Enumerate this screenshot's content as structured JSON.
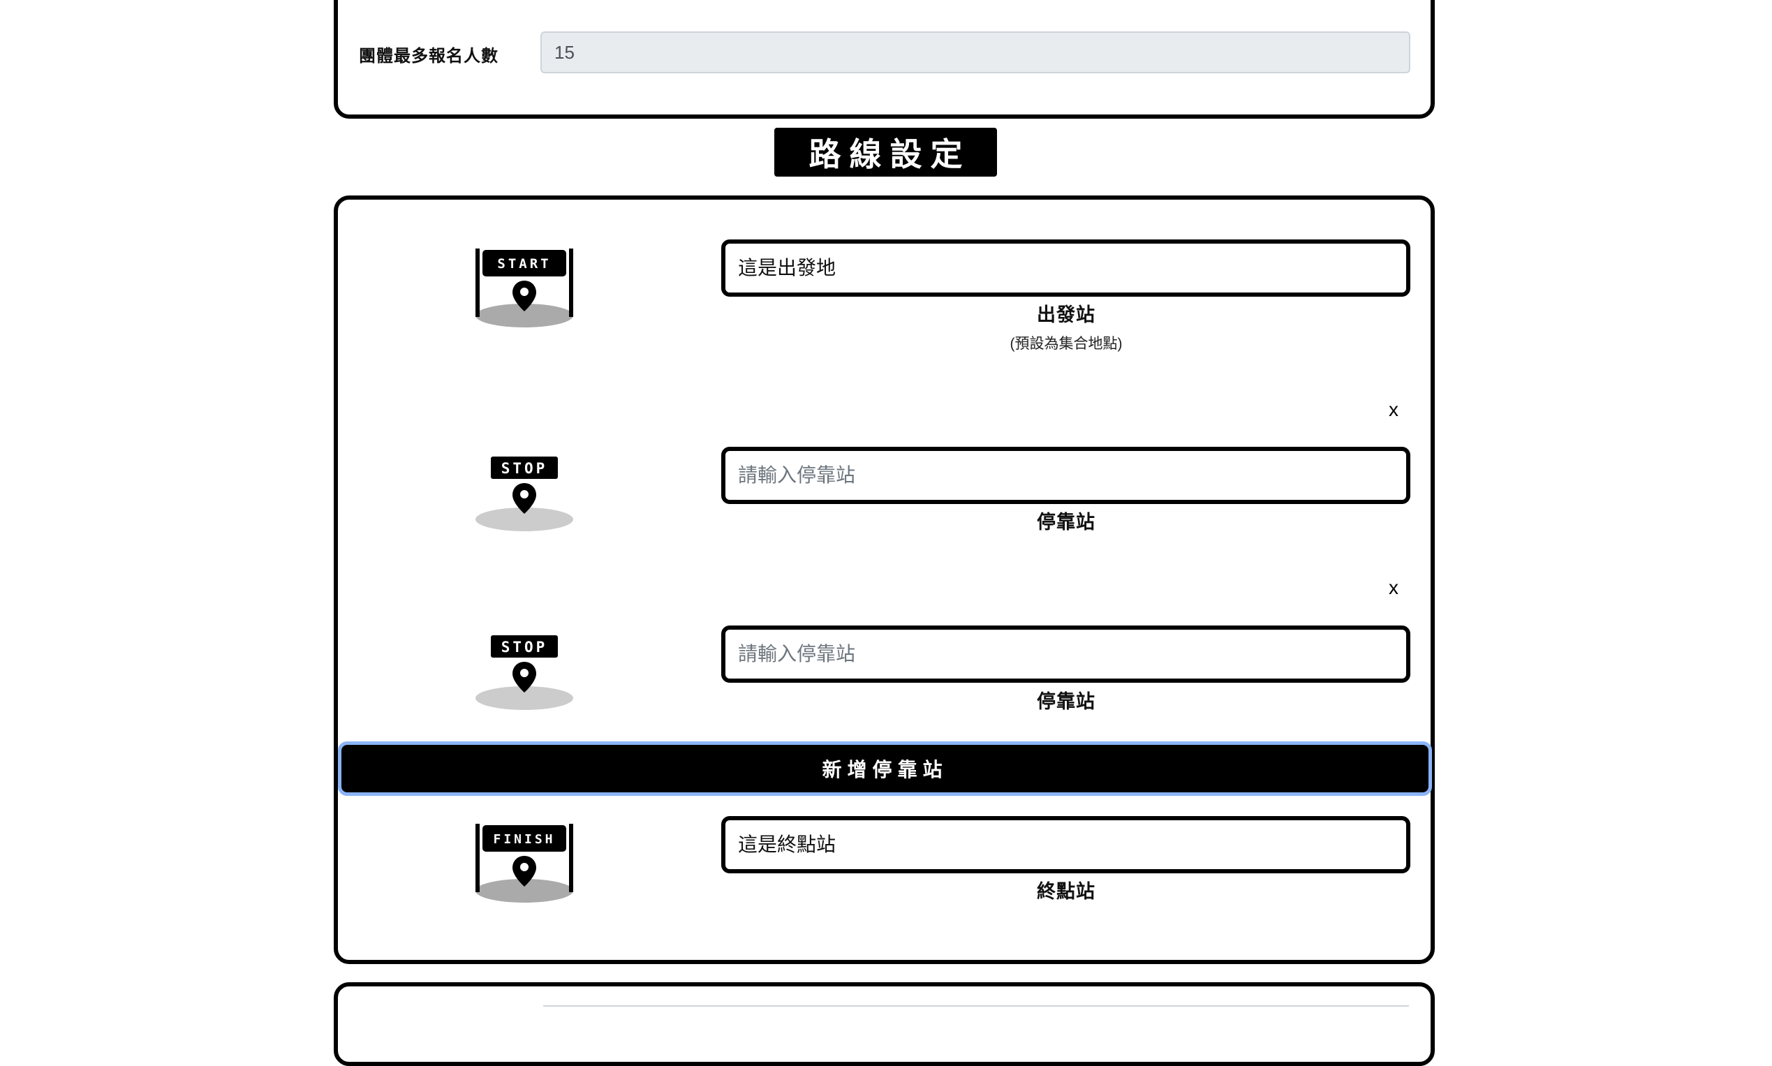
{
  "group_settings": {
    "max_signup_label": "團體最多報名人數",
    "max_signup_value": "15"
  },
  "route_settings": {
    "title": "路線設定",
    "start": {
      "badge": "START",
      "value": "這是出發地",
      "label": "出發站",
      "note": "(預設為集合地點)"
    },
    "stops": [
      {
        "badge": "STOP",
        "placeholder": "請輸入停靠站",
        "label": "停靠站",
        "remove": "x"
      },
      {
        "badge": "STOP",
        "placeholder": "請輸入停靠站",
        "label": "停靠站",
        "remove": "x"
      }
    ],
    "add_stop_label": "新增停靠站",
    "finish": {
      "badge": "FINISH",
      "value": "這是終點站",
      "label": "終點站"
    }
  },
  "colors": {
    "border": "#000000",
    "readonly_bg": "#e9ecef",
    "focus_ring": "#8ab4f8",
    "icon_shadow": "#cccccc"
  },
  "icons": [
    "start-marker-icon",
    "stop-marker-icon",
    "finish-marker-icon",
    "map-pin-icon"
  ]
}
